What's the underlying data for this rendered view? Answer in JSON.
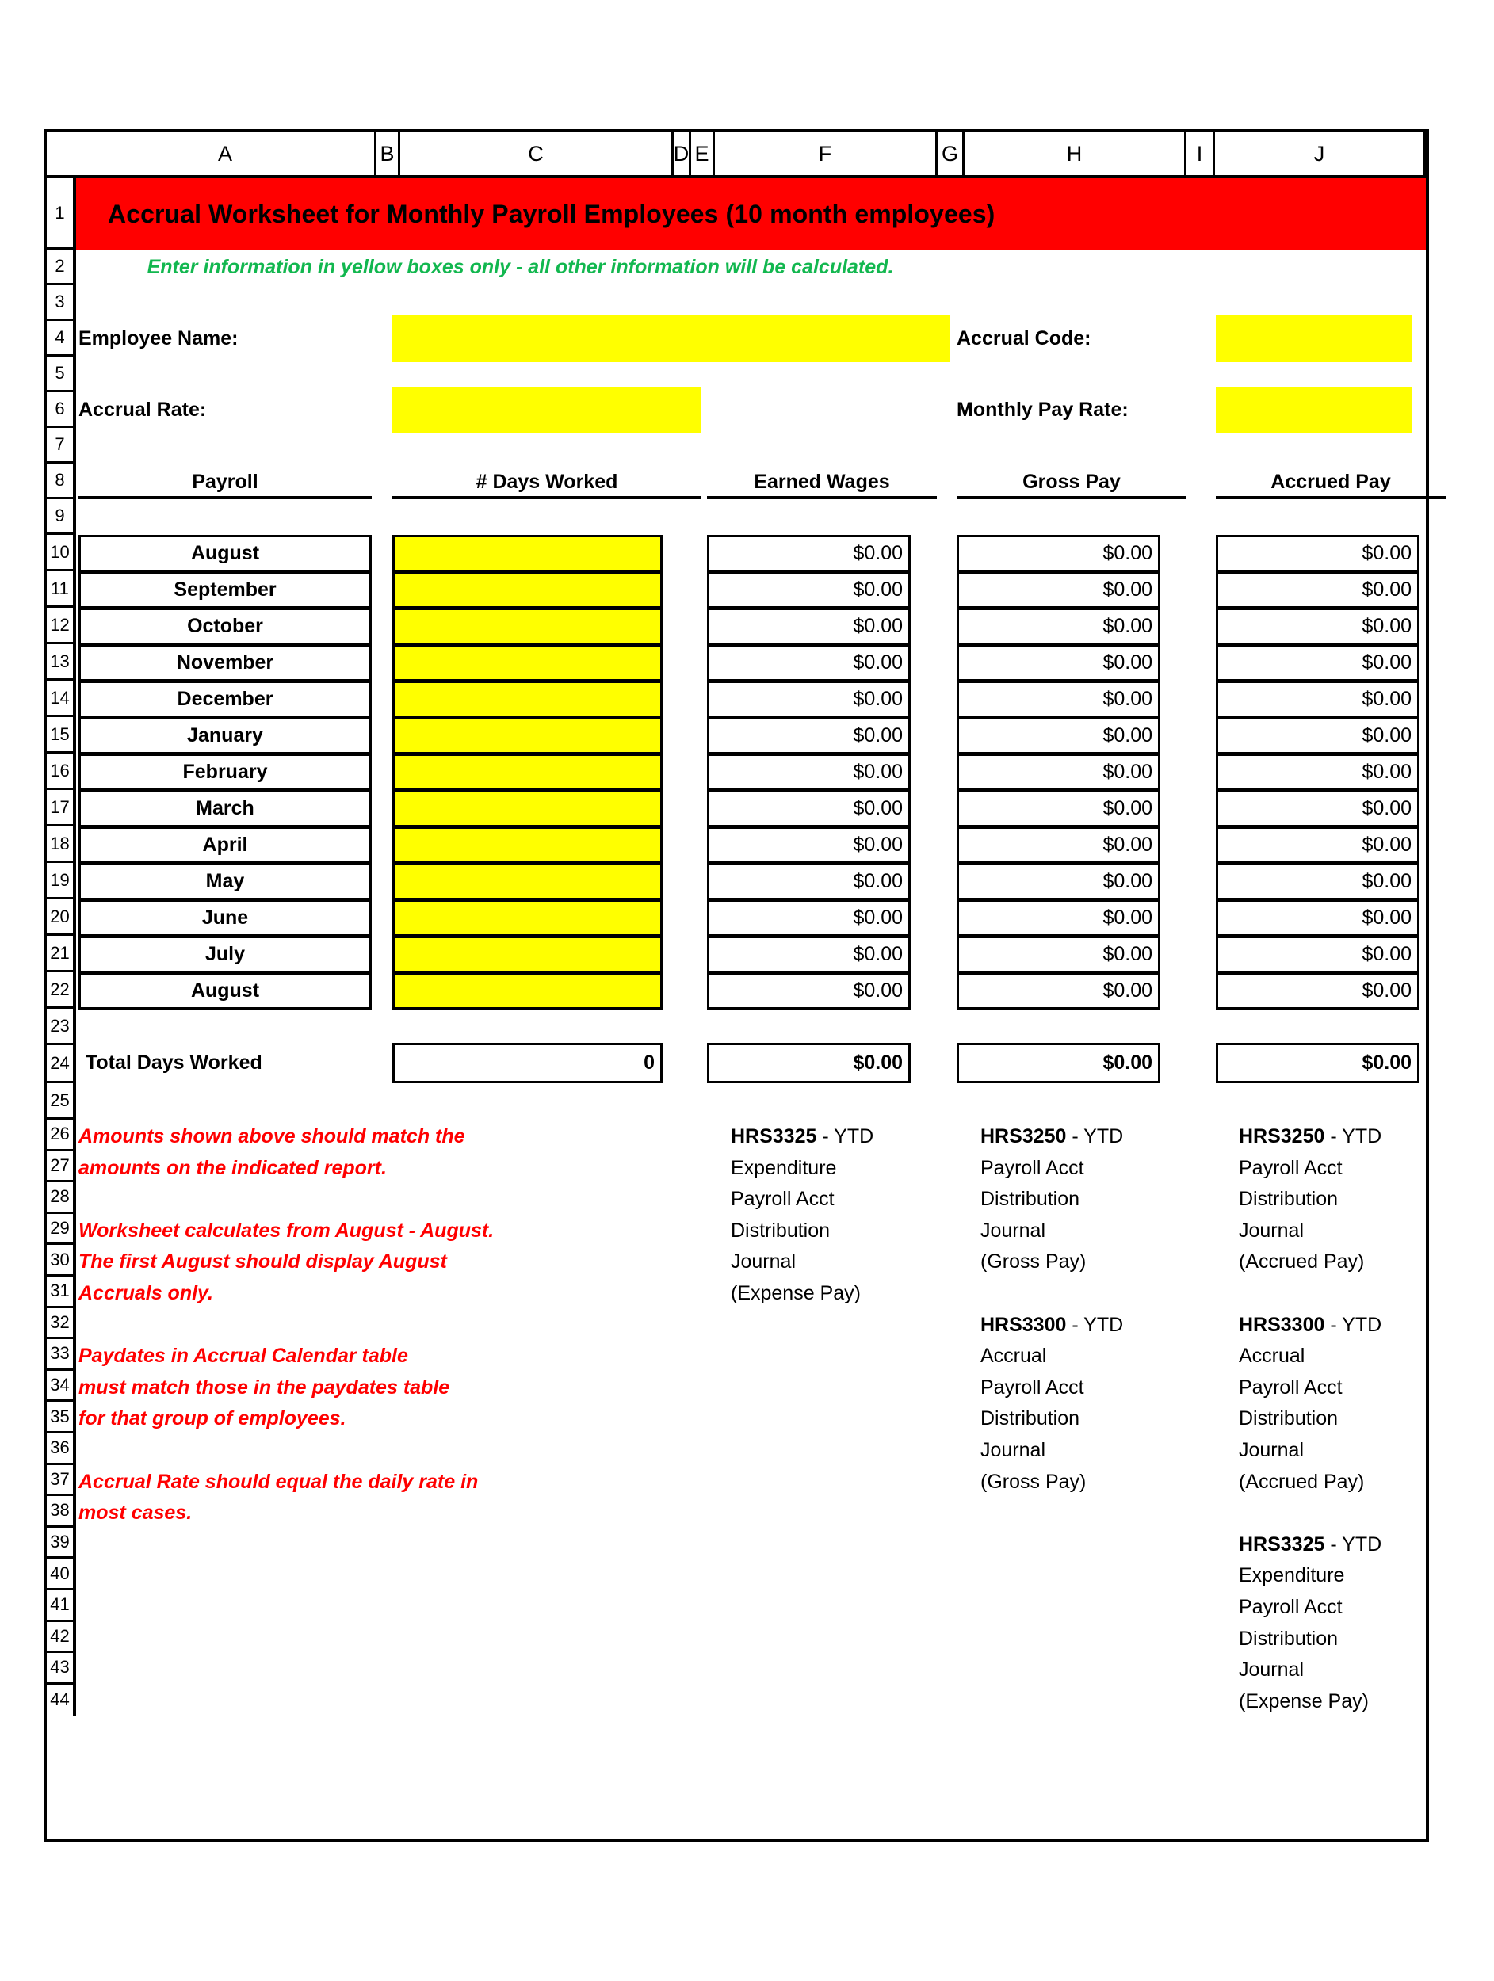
{
  "worksheet": {
    "title": "Accrual Worksheet for Monthly Payroll Employees (10 month employees)",
    "subtitle": "Enter information in yellow boxes only - all other information will be calculated.",
    "title_bg": "#FF0000",
    "subtitle_color": "#12B74F",
    "input_color": "#FFFF00",
    "note_color": "#FF0000"
  },
  "column_headers": [
    "A",
    "B",
    "C",
    "D",
    "E",
    "F",
    "G",
    "H",
    "I",
    "J"
  ],
  "row_numbers": [
    1,
    2,
    3,
    4,
    5,
    6,
    7,
    8,
    9,
    10,
    11,
    12,
    13,
    14,
    15,
    16,
    17,
    18,
    19,
    20,
    21,
    22,
    23,
    24,
    25,
    26,
    27,
    28,
    29,
    30,
    31,
    32,
    33,
    34,
    35,
    36,
    37,
    38,
    39,
    40,
    41,
    42,
    43,
    44
  ],
  "fields": {
    "employee_name_label": "Employee Name:",
    "employee_name_value": "",
    "accrual_code_label": "Accrual Code:",
    "accrual_code_value": "",
    "accrual_rate_label": "Accrual Rate:",
    "accrual_rate_value": "",
    "monthly_pay_rate_label": "Monthly Pay Rate:",
    "monthly_pay_rate_value": ""
  },
  "table": {
    "headers": [
      "Payroll",
      "# Days Worked",
      "Earned Wages",
      "Gross Pay",
      "Accrued Pay"
    ],
    "rows": [
      {
        "payroll": "August",
        "days": "",
        "earned": "$0.00",
        "gross": "$0.00",
        "accrued": "$0.00"
      },
      {
        "payroll": "September",
        "days": "",
        "earned": "$0.00",
        "gross": "$0.00",
        "accrued": "$0.00"
      },
      {
        "payroll": "October",
        "days": "",
        "earned": "$0.00",
        "gross": "$0.00",
        "accrued": "$0.00"
      },
      {
        "payroll": "November",
        "days": "",
        "earned": "$0.00",
        "gross": "$0.00",
        "accrued": "$0.00"
      },
      {
        "payroll": "December",
        "days": "",
        "earned": "$0.00",
        "gross": "$0.00",
        "accrued": "$0.00"
      },
      {
        "payroll": "January",
        "days": "",
        "earned": "$0.00",
        "gross": "$0.00",
        "accrued": "$0.00"
      },
      {
        "payroll": "February",
        "days": "",
        "earned": "$0.00",
        "gross": "$0.00",
        "accrued": "$0.00"
      },
      {
        "payroll": "March",
        "days": "",
        "earned": "$0.00",
        "gross": "$0.00",
        "accrued": "$0.00"
      },
      {
        "payroll": "April",
        "days": "",
        "earned": "$0.00",
        "gross": "$0.00",
        "accrued": "$0.00"
      },
      {
        "payroll": "May",
        "days": "",
        "earned": "$0.00",
        "gross": "$0.00",
        "accrued": "$0.00"
      },
      {
        "payroll": "June",
        "days": "",
        "earned": "$0.00",
        "gross": "$0.00",
        "accrued": "$0.00"
      },
      {
        "payroll": "July",
        "days": "",
        "earned": "$0.00",
        "gross": "$0.00",
        "accrued": "$0.00"
      },
      {
        "payroll": "August",
        "days": "",
        "earned": "$0.00",
        "gross": "$0.00",
        "accrued": "$0.00"
      }
    ],
    "total": {
      "label": "Total Days Worked",
      "days": "0",
      "earned": "$0.00",
      "gross": "$0.00",
      "accrued": "$0.00"
    }
  },
  "notes": {
    "red": [
      "Amounts shown above should match the",
      "amounts on the indicated report.",
      "",
      "Worksheet calculates from August - August.",
      "The first August should display August",
      "Accruals only.",
      "",
      "Paydates in Accrual Calendar table",
      "must match those in the paydates table",
      "for that group of employees.",
      "",
      "Accrual Rate should equal the daily rate in",
      "most cases."
    ],
    "earned_wages_note": {
      "code": "HRS3325",
      "lines": [
        "HRS3325 - YTD",
        "Expenditure",
        "Payroll Acct",
        "Distribution",
        "Journal",
        "(Expense Pay)"
      ]
    },
    "gross_pay_note": {
      "lines": [
        "HRS3250 - YTD",
        "Payroll Acct",
        "Distribution",
        "Journal",
        "(Gross Pay)",
        "",
        "HRS3300 - YTD",
        "Accrual",
        "Payroll Acct",
        "Distribution",
        "Journal",
        "(Gross Pay)"
      ]
    },
    "accrued_pay_note": {
      "lines": [
        "HRS3250 - YTD",
        "Payroll Acct",
        "Distribution",
        "Journal",
        "(Accrued Pay)",
        "",
        "HRS3300 - YTD",
        "Accrual",
        "Payroll Acct",
        "Distribution",
        "Journal",
        "(Accrued Pay)",
        "",
        "HRS3325 - YTD",
        "Expenditure",
        "Payroll Acct",
        "Distribution",
        "Journal",
        "(Expense Pay)"
      ]
    }
  }
}
